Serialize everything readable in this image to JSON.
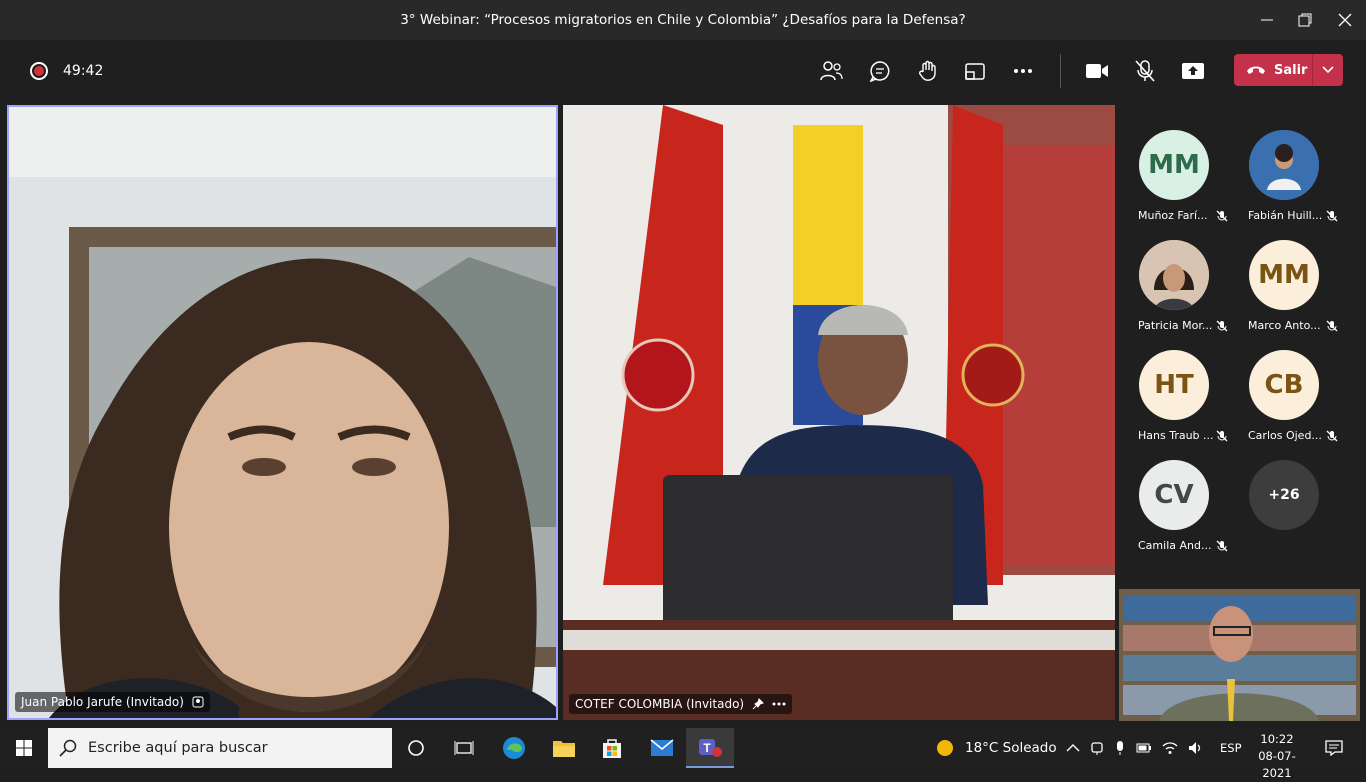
{
  "window": {
    "title": "3° Webinar: “Procesos migratorios en Chile y Colombia” ¿Desafíos para la Defensa?"
  },
  "toolbar": {
    "timer": "49:42",
    "leave_label": "Salir"
  },
  "tiles": [
    {
      "name": "Juan Pablo Jarufe (Invitado)"
    },
    {
      "name": "COTEF COLOMBIA (Invitado)"
    }
  ],
  "participants": [
    {
      "initials": "MM",
      "name": "Muñoz Farí...",
      "avatar_color": "#d9f0e4",
      "text_color": "#2e6b4a"
    },
    {
      "initials": "",
      "name": "Fabián Huill...",
      "avatar_color": "#3a6fb0",
      "text_color": "#ffffff"
    },
    {
      "initials": "",
      "name": "Patricia Mor...",
      "avatar_color": "#c7a58a",
      "text_color": "#ffffff"
    },
    {
      "initials": "MM",
      "name": "Marco Anto...",
      "avatar_color": "#fbeedb",
      "text_color": "#7a5412"
    },
    {
      "initials": "HT",
      "name": "Hans Traub ...",
      "avatar_color": "#fbeedb",
      "text_color": "#7a5412"
    },
    {
      "initials": "CB",
      "name": "Carlos Ojed...",
      "avatar_color": "#fbeedb",
      "text_color": "#7a5412"
    },
    {
      "initials": "CV",
      "name": "Camila And...",
      "avatar_color": "#e9ecea",
      "text_color": "#3f4a44"
    }
  ],
  "overflow": {
    "label": "+26"
  },
  "taskbar": {
    "search_placeholder": "Escribe aquí para buscar",
    "weather": "18°C  Soleado",
    "language": "ESP",
    "time": "10:22",
    "date": "08-07-2021"
  }
}
